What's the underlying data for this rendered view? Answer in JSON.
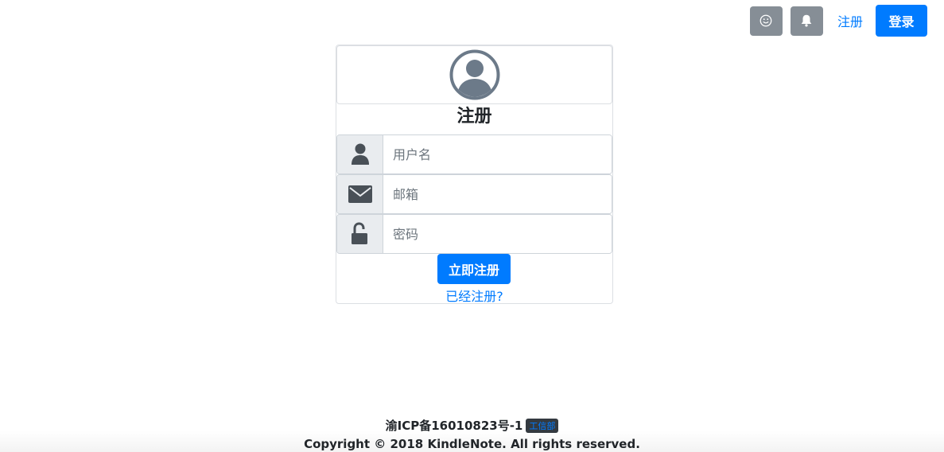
{
  "nav": {
    "emoji_icon": "smiley-icon",
    "bell_icon": "bell-icon",
    "register_link": "注册",
    "login_button": "登录"
  },
  "form": {
    "avatar_icon": "user-circle-icon",
    "title": "注册",
    "username": {
      "icon": "user-icon",
      "placeholder": "用户名",
      "value": ""
    },
    "email": {
      "icon": "envelope-icon",
      "placeholder": "邮箱",
      "value": ""
    },
    "password": {
      "icon": "unlock-icon",
      "placeholder": "密码",
      "value": ""
    },
    "submit_label": "立即注册",
    "already_registered_link": "已经注册?"
  },
  "footer": {
    "icp": "渝ICP备16010823号-1",
    "badge": "工信部",
    "copyright": "Copyright © 2018 KindleNote. All rights reserved."
  },
  "colors": {
    "primary": "#007bff",
    "icon_button_bg": "#868e96",
    "addon_bg": "#e9ecef",
    "icon_dark": "#495057",
    "avatar_gray": "#6c7a89"
  }
}
